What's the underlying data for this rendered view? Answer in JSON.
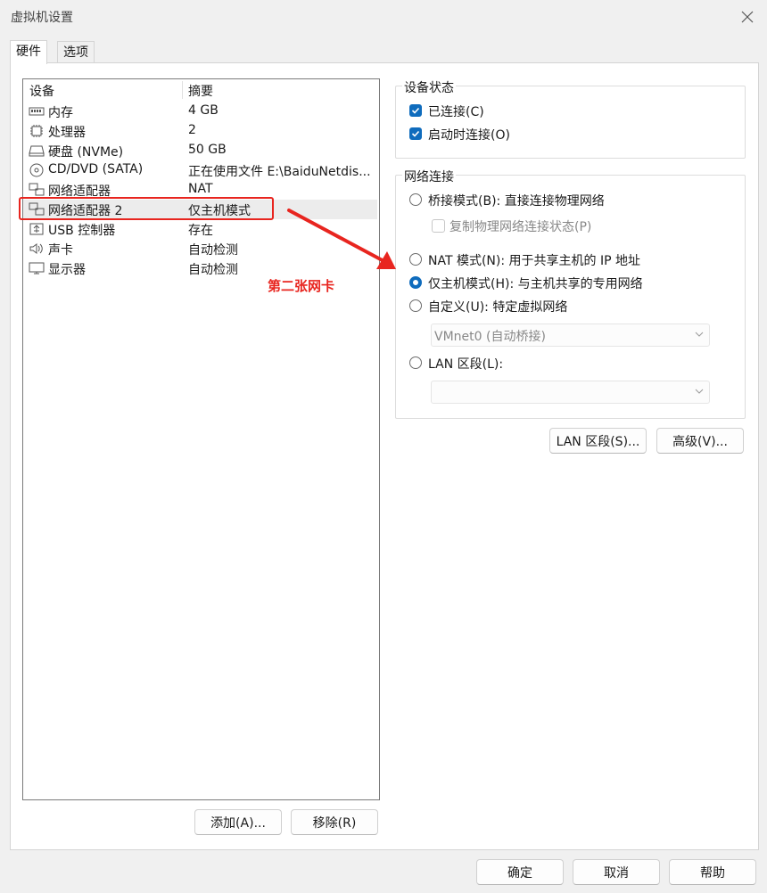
{
  "window": {
    "title": "虚拟机设置",
    "close_icon": "close-icon"
  },
  "tabs": [
    {
      "label": "硬件",
      "active": true
    },
    {
      "label": "选项",
      "active": false
    }
  ],
  "device_list": {
    "headers": {
      "device": "设备",
      "summary": "摘要"
    },
    "rows": [
      {
        "icon": "memory-icon",
        "name": "内存",
        "summary": "4 GB",
        "selected": false
      },
      {
        "icon": "processor-icon",
        "name": "处理器",
        "summary": "2",
        "selected": false
      },
      {
        "icon": "hard-disk-icon",
        "name": "硬盘 (NVMe)",
        "summary": "50 GB",
        "selected": false
      },
      {
        "icon": "cd-dvd-icon",
        "name": "CD/DVD (SATA)",
        "summary": "正在使用文件 E:\\BaiduNetdis...",
        "selected": false
      },
      {
        "icon": "network-adapter-icon",
        "name": "网络适配器",
        "summary": "NAT",
        "selected": false
      },
      {
        "icon": "network-adapter-icon",
        "name": "网络适配器 2",
        "summary": "仅主机模式",
        "selected": true
      },
      {
        "icon": "usb-icon",
        "name": "USB 控制器",
        "summary": "存在",
        "selected": false
      },
      {
        "icon": "sound-card-icon",
        "name": "声卡",
        "summary": "自动检测",
        "selected": false
      },
      {
        "icon": "display-icon",
        "name": "显示器",
        "summary": "自动检测",
        "selected": false
      }
    ]
  },
  "left_buttons": {
    "add": "添加(A)...",
    "remove": "移除(R)"
  },
  "device_status": {
    "title": "设备状态",
    "connected": {
      "label": "已连接(C)",
      "checked": true
    },
    "connect_on_power_on": {
      "label": "启动时连接(O)",
      "checked": true
    }
  },
  "network": {
    "title": "网络连接",
    "bridged": {
      "label": "桥接模式(B): 直接连接物理网络",
      "selected": false
    },
    "replicate": {
      "label": "复制物理网络连接状态(P)",
      "checked": false
    },
    "nat": {
      "label": "NAT 模式(N): 用于共享主机的 IP 地址",
      "selected": false
    },
    "host_only": {
      "label": "仅主机模式(H): 与主机共享的专用网络",
      "selected": true
    },
    "custom": {
      "label": "自定义(U): 特定虚拟网络",
      "selected": false
    },
    "custom_select": "VMnet0 (自动桥接)",
    "lan_segment": {
      "label": "LAN 区段(L):",
      "selected": false
    },
    "lan_select": ""
  },
  "right_buttons": {
    "lan_segments": "LAN 区段(S)...",
    "advanced": "高级(V)..."
  },
  "annotation": {
    "text": "第二张网卡",
    "color": "#e8251f"
  },
  "footer": {
    "ok": "确定",
    "cancel": "取消",
    "help": "帮助"
  },
  "colors": {
    "accent": "#0f6cbd",
    "annotation": "#e8251f"
  }
}
